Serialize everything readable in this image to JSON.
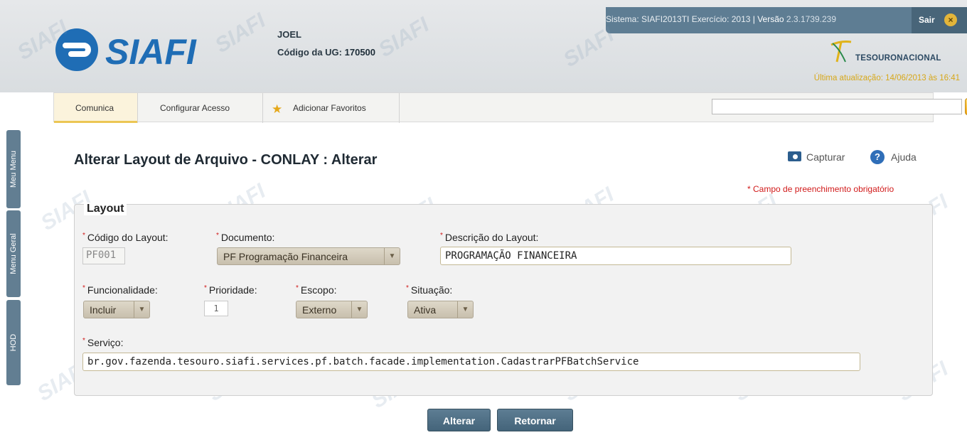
{
  "brand": {
    "name": "SIAFI",
    "partner": "TESOURONACIONAL"
  },
  "user": {
    "name": "JOEL",
    "ug_label": "Código da UG:",
    "ug_code": "170500"
  },
  "system": {
    "info": "Sistema: SIAFI2013TI Exercício: 2013 ",
    "version_label": "| Versão ",
    "version_number": "2.3.1739.239",
    "logout_label": "Sair",
    "last_update": "Última atualização: 14/06/2013 às 16:41"
  },
  "menu": {
    "tabs": [
      "Comunica",
      "Configurar Acesso",
      "Adicionar Favoritos"
    ],
    "search_placeholder": ""
  },
  "side_tabs": {
    "meu_menu": "Meu Menu",
    "menu_geral": "Menu Geral",
    "hod": "HOD"
  },
  "page": {
    "title": "Alterar Layout de Arquivo - CONLAY : Alterar",
    "capture_label": "Capturar",
    "help_label": "Ajuda",
    "required_note": "* Campo de preenchimento obrigatório"
  },
  "form": {
    "legend": "Layout",
    "codigo": {
      "label": "Código do Layout:",
      "value": "PF001"
    },
    "documento": {
      "label": "Documento:",
      "value": "PF Programação Financeira"
    },
    "descricao": {
      "label": "Descrição do Layout:",
      "value": "PROGRAMAÇÃO FINANCEIRA"
    },
    "funcionalidade": {
      "label": "Funcionalidade:",
      "value": "Incluir"
    },
    "prioridade": {
      "label": "Prioridade:",
      "value": "1"
    },
    "escopo": {
      "label": "Escopo:",
      "value": "Externo"
    },
    "situacao": {
      "label": "Situação:",
      "value": "Ativa"
    },
    "servico": {
      "label": "Serviço:",
      "value": "br.gov.fazenda.tesouro.siafi.services.pf.batch.facade.implementation.CadastrarPFBatchService"
    }
  },
  "buttons": {
    "alterar": "Alterar",
    "retornar": "Retornar"
  }
}
